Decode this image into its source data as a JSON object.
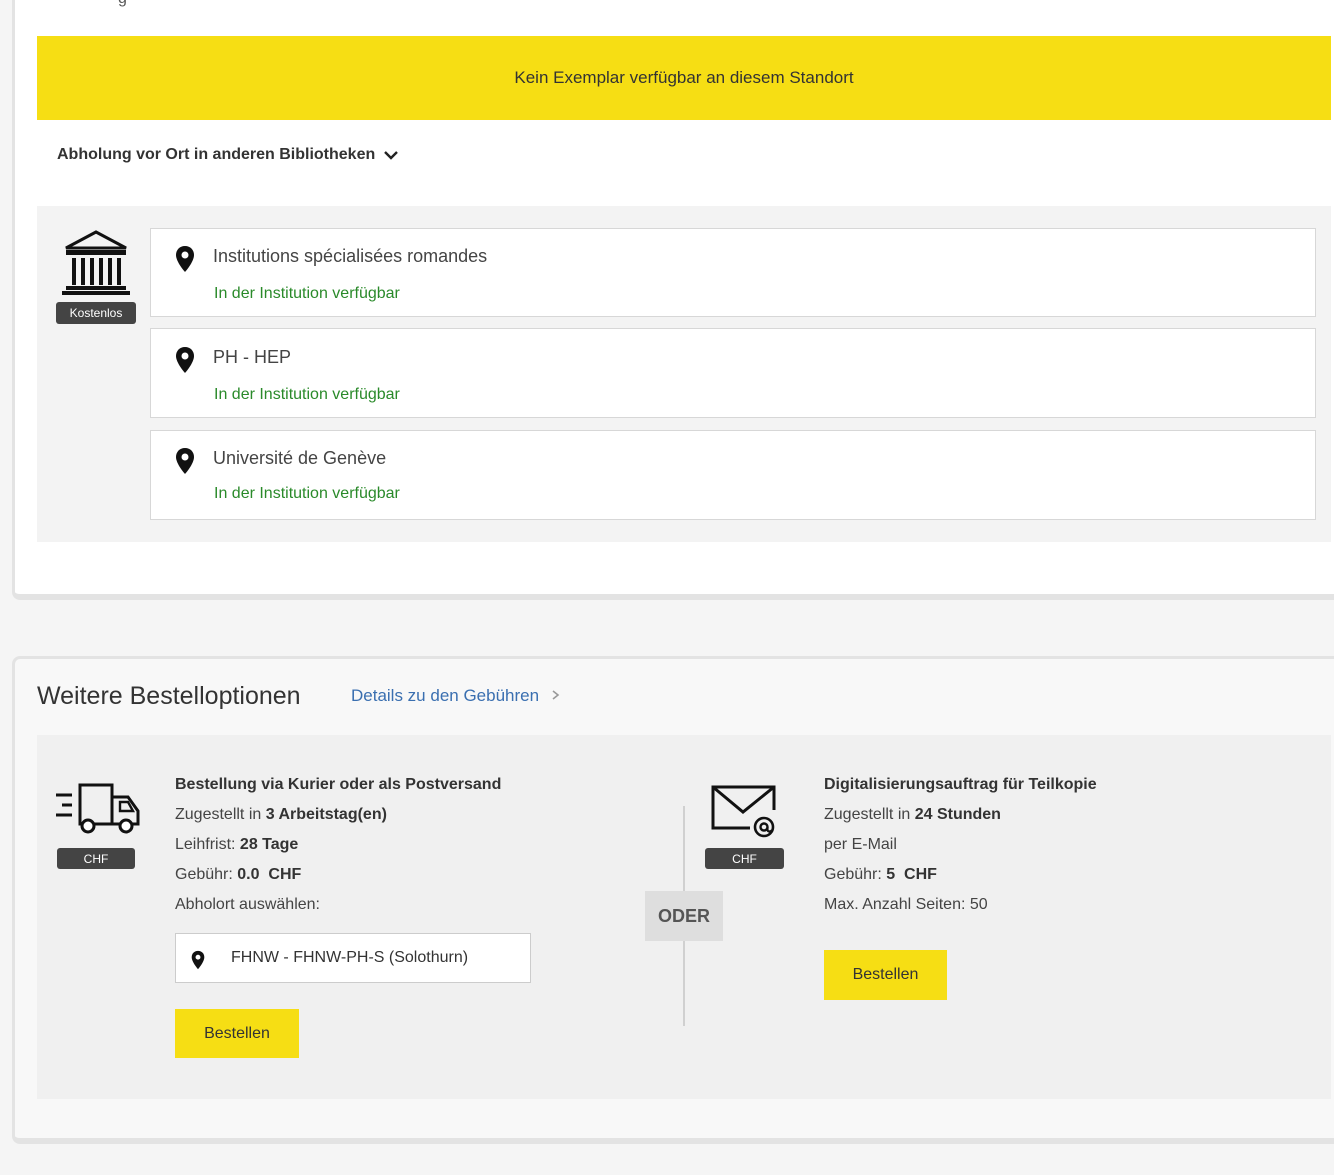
{
  "cut_text": "g",
  "availability_banner": "Kein Exemplar verfügbar an diesem Standort",
  "pickup_toggle_label": "Abholung vor Ort in anderen Bibliotheken",
  "institution_badge": "Kostenlos",
  "locations": [
    {
      "name": "Institutions spécialisées romandes",
      "status": "In der Institution verfügbar"
    },
    {
      "name": "PH - HEP",
      "status": "In der Institution verfügbar"
    },
    {
      "name": "Université de Genève",
      "status": "In der Institution verfügbar"
    }
  ],
  "further_options": {
    "title": "Weitere Bestelloptionen",
    "details_link": "Details zu den Gebühren",
    "separator": "ODER",
    "courier": {
      "badge": "CHF",
      "title": "Bestellung via Kurier oder als Postversand",
      "delivered_prefix": "Zugestellt in ",
      "delivered_value": "3 Arbeitstag(en)",
      "loan_prefix": "Leihfrist: ",
      "loan_value": "28 Tage",
      "fee_prefix": "Gebühr: ",
      "fee_value": "0.0  CHF",
      "pickup_label": "Abholort auswählen:",
      "pickup_value": "FHNW - FHNW-PH-S (Solothurn)",
      "button": "Bestellen"
    },
    "digitization": {
      "badge": "CHF",
      "title": "Digitalisierungsauftrag für Teilkopie",
      "delivered_prefix": "Zugestellt in ",
      "delivered_value": "24 Stunden",
      "via": "per E-Mail",
      "fee_prefix": "Gebühr: ",
      "fee_value": "5  CHF",
      "max_pages": "Max. Anzahl Seiten: 50",
      "button": "Bestellen"
    }
  }
}
